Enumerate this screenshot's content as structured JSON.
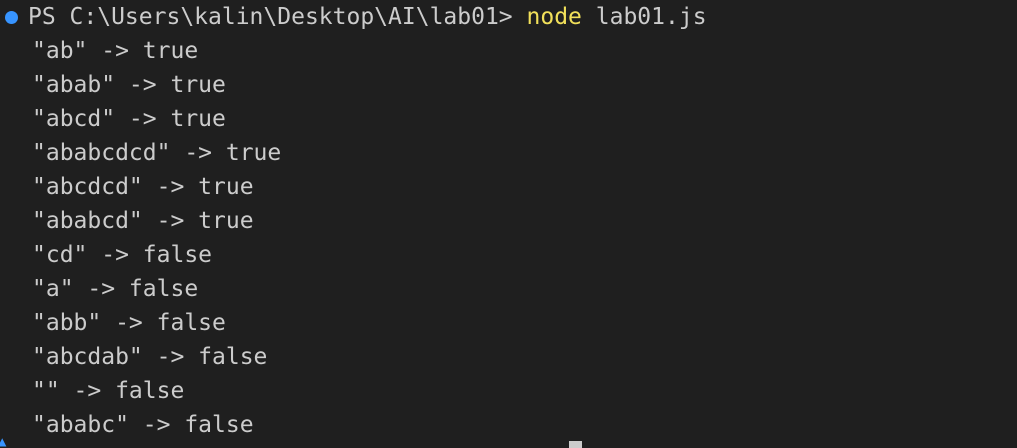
{
  "terminal": {
    "prompt": "PS C:\\Users\\kalin\\Desktop\\AI\\lab01>",
    "command": "node",
    "command_arg": "lab01.js",
    "output": [
      "\"ab\" -> true",
      "\"abab\" -> true",
      "\"abcd\" -> true",
      "\"ababcdcd\" -> true",
      "\"abcdcd\" -> true",
      "\"ababcd\" -> true",
      "\"cd\" -> false",
      "\"a\" -> false",
      "\"abb\" -> false",
      "\"abcdab\" -> false",
      "\"\" -> false",
      "\"ababc\" -> false"
    ],
    "colors": {
      "background": "#1f1f1f",
      "text": "#cccccc",
      "command": "#f1e05a",
      "status_dot": "#3794ff"
    }
  }
}
